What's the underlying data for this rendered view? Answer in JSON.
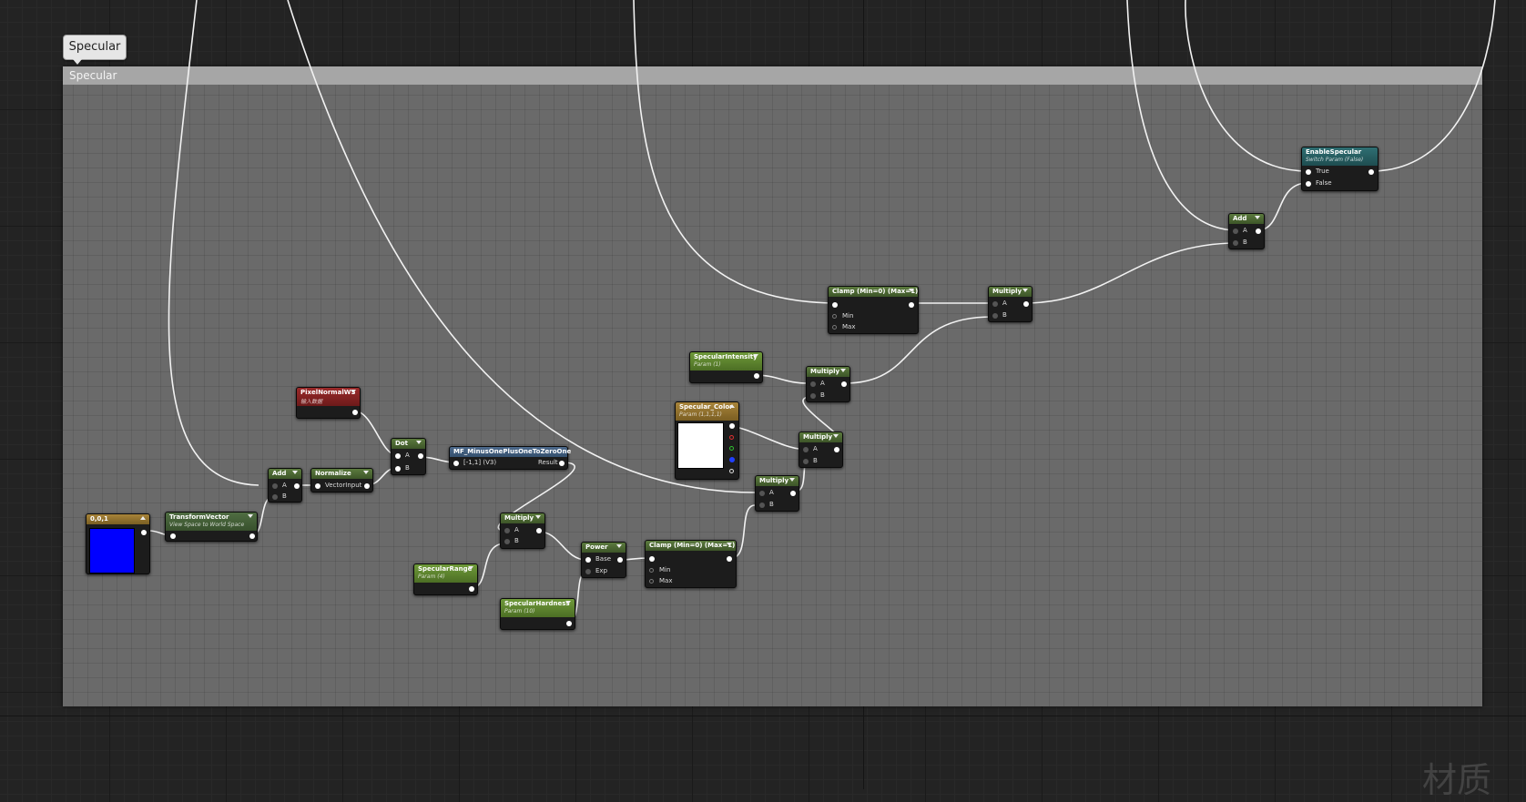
{
  "comment": {
    "tab_label": "Specular",
    "header_label": "Specular"
  },
  "nodes": {
    "constant": {
      "title": "0,0,1",
      "color": "#0000ff"
    },
    "transform_vector": {
      "title": "TransformVector",
      "subtitle": "View Space to World Space"
    },
    "add_1": {
      "title": "Add",
      "pin_a": "A",
      "pin_b": "B"
    },
    "normalize": {
      "title": "Normalize",
      "pin_in": "VectorInput"
    },
    "pixel_normal": {
      "title": "PixelNormalWS",
      "subtitle": "输入数据"
    },
    "dot": {
      "title": "Dot",
      "pin_a": "A",
      "pin_b": "B"
    },
    "mf_minus": {
      "title": "MF_MinusOnePlusOneToZeroOne",
      "pin_in": "[-1,1] (V3)",
      "pin_out": "Result"
    },
    "multiply_1": {
      "title": "Multiply",
      "pin_a": "A",
      "pin_b": "B"
    },
    "specular_range": {
      "title": "SpecularRange",
      "subtitle": "Param (4)"
    },
    "specular_hardness": {
      "title": "SpecularHardness",
      "subtitle": "Param (10)"
    },
    "power": {
      "title": "Power",
      "pin_base": "Base",
      "pin_exp": "Exp"
    },
    "clamp_1": {
      "title": "Clamp (Min=0) (Max=1)",
      "pin_min": "Min",
      "pin_max": "Max"
    },
    "specular_color": {
      "title": "Specular_Color",
      "subtitle": "Param (1,1,1,1)",
      "color": "#ffffff"
    },
    "multiply_2": {
      "title": "Multiply",
      "pin_a": "A",
      "pin_b": "B"
    },
    "multiply_3": {
      "title": "Multiply",
      "pin_a": "A",
      "pin_b": "B"
    },
    "specular_intensity": {
      "title": "SpecularIntensity",
      "subtitle": "Param (1)"
    },
    "multiply_4": {
      "title": "Multiply",
      "pin_a": "A",
      "pin_b": "B"
    },
    "clamp_2": {
      "title": "Clamp (Min=0) (Max=1)",
      "pin_min": "Min",
      "pin_max": "Max"
    },
    "multiply_5": {
      "title": "Multiply",
      "pin_a": "A",
      "pin_b": "B"
    },
    "add_2": {
      "title": "Add",
      "pin_a": "A",
      "pin_b": "B"
    },
    "enable_specular": {
      "title": "EnableSpecular",
      "subtitle": "Switch Param (False)",
      "pin_true": "True",
      "pin_false": "False"
    }
  },
  "watermark": "材质"
}
